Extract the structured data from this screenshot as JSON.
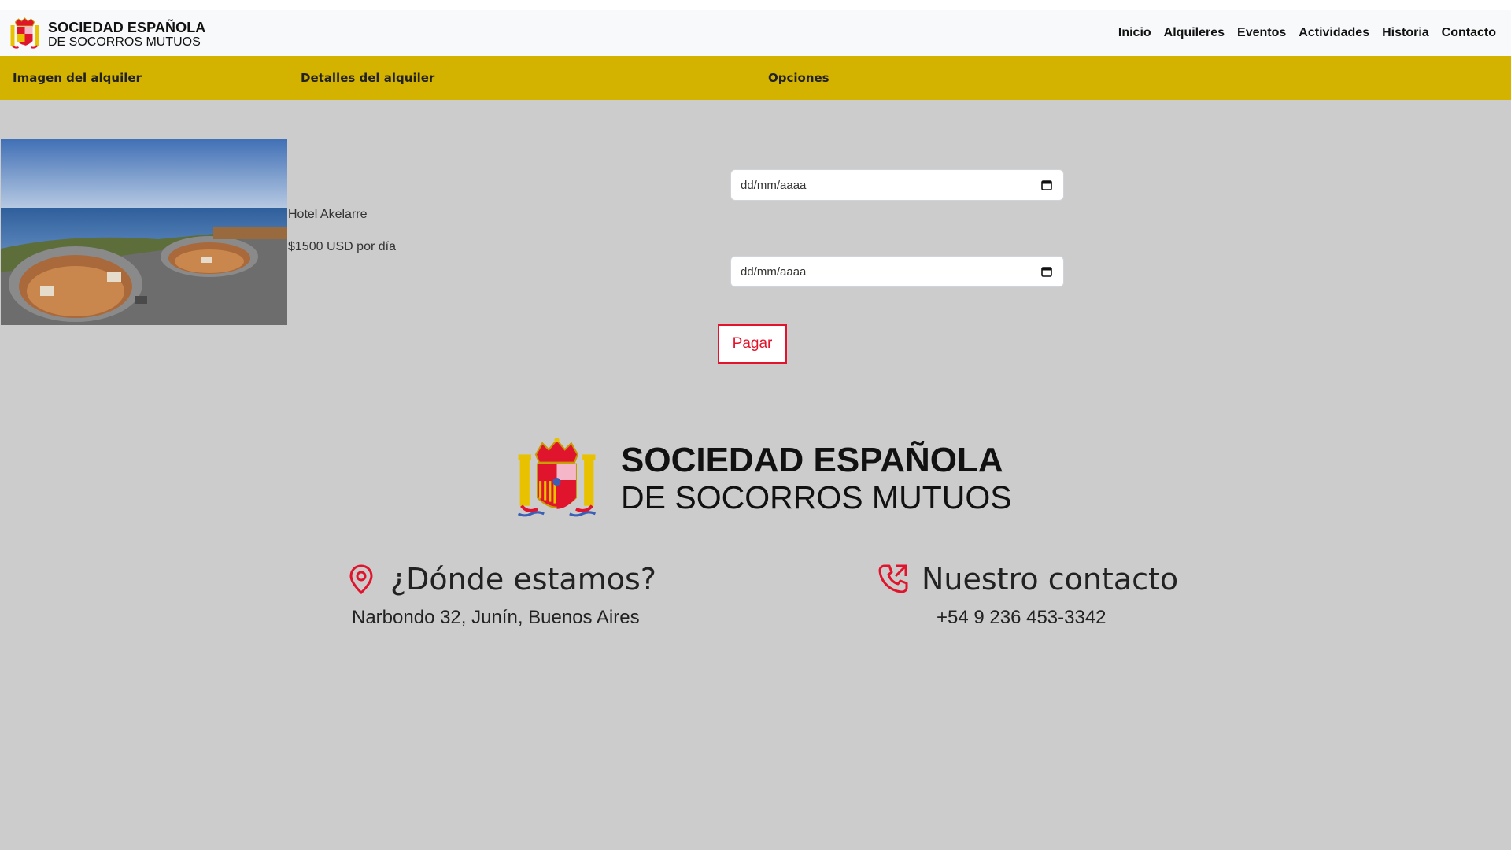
{
  "header": {
    "brand_line1": "SOCIEDAD ESPAÑOLA",
    "brand_line2": "DE SOCORROS MUTUOS",
    "nav": [
      "Inicio",
      "Alquileres",
      "Eventos",
      "Actividades",
      "Historia",
      "Contacto"
    ]
  },
  "table": {
    "headers": [
      "Imagen del alquiler",
      "Detalles del alquiler",
      "Opciones"
    ],
    "rental": {
      "name": "Hotel Akelarre",
      "price": "$1500 USD por día",
      "date_start_placeholder": "dd/mm/aaaa",
      "date_end_placeholder": "dd/mm/aaaa",
      "pay_label": "Pagar"
    }
  },
  "footer": {
    "logo_line1": "SOCIEDAD ESPAÑOLA",
    "logo_line2": "DE SOCORROS MUTUOS",
    "location_title": "¿Dónde estamos?",
    "location_text": "Narbondo 32, Junín, Buenos Aires",
    "contact_title": "Nuestro contacto",
    "contact_text": "+54 9 236 453-3342"
  },
  "colors": {
    "navbar_bg": "#f8f9fa",
    "table_header_bg": "#d4b300",
    "page_bg": "#cccccc",
    "accent_red": "#e0142c"
  },
  "icons": [
    "spain-coat-of-arms-logo",
    "calendar-icon",
    "location-pin-icon",
    "phone-icon"
  ]
}
